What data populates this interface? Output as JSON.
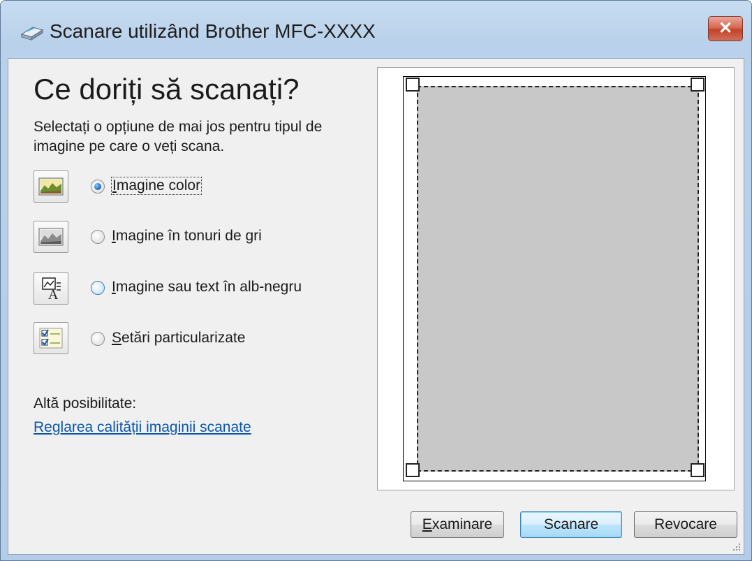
{
  "window": {
    "title": "Scanare utilizând Brother MFC-XXXX",
    "close_label": "✕"
  },
  "main": {
    "heading": "Ce doriți să scanați?",
    "instructions": "Selectați o opțiune de mai jos pentru tipul de imagine pe care o veți scana.",
    "options": [
      {
        "first": "I",
        "rest": "magine color",
        "checked": true,
        "icon": "color-picture-icon"
      },
      {
        "first": "I",
        "rest": "magine în tonuri de gri",
        "checked": false,
        "icon": "grayscale-picture-icon"
      },
      {
        "first": "I",
        "rest": "magine sau text în alb-negru",
        "checked": false,
        "icon": "black-white-text-icon"
      },
      {
        "first": "S",
        "rest": "etări particularizate",
        "checked": false,
        "icon": "custom-settings-icon"
      }
    ],
    "alt_label": "Altă posibilitate:",
    "quality_link": "Reglarea calității imaginii scanate"
  },
  "buttons": {
    "preview_first": "E",
    "preview_rest": "xaminare",
    "scan": "Scanare",
    "cancel": "Revocare"
  },
  "colors": {
    "link": "#0a56b0",
    "scan_area": "#c8c8c8",
    "accent": "#3c7fb1"
  }
}
